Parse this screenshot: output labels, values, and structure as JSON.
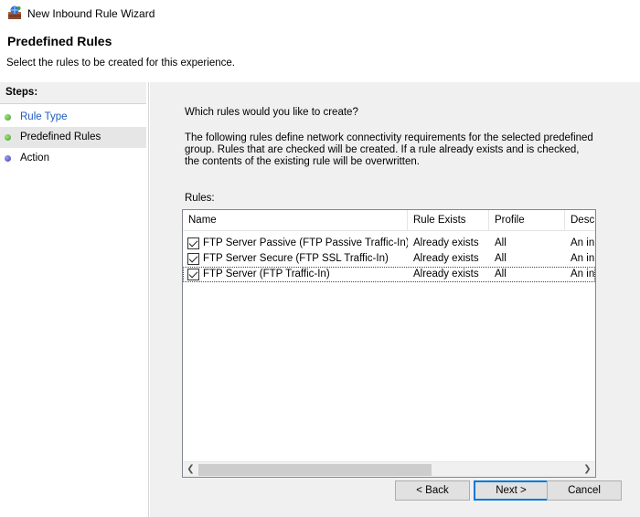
{
  "window": {
    "title": "New Inbound Rule Wizard",
    "icon": "firewall-wizard-icon"
  },
  "header": {
    "title": "Predefined Rules",
    "subtitle": "Select the rules to be created for this experience."
  },
  "steps": {
    "label": "Steps:",
    "items": [
      {
        "label": "Rule Type",
        "state": "done",
        "color": "#3f9c2c"
      },
      {
        "label": "Predefined Rules",
        "state": "current",
        "color": "#3f9c2c"
      },
      {
        "label": "Action",
        "state": "pending",
        "color": "#3e3fb0"
      }
    ]
  },
  "main": {
    "question": "Which rules would you like to create?",
    "description": "The following rules define network connectivity requirements for the selected predefined group. Rules that are checked will be created. If a rule already exists and is checked, the contents of the existing rule will be overwritten.",
    "rules_label": "Rules:",
    "columns": [
      "Name",
      "Rule Exists",
      "Profile",
      "Desc"
    ],
    "rows": [
      {
        "checked": true,
        "name": "FTP Server Passive (FTP Passive Traffic-In)",
        "exists": "Already exists",
        "profile": "All",
        "desc": "An in"
      },
      {
        "checked": true,
        "name": "FTP Server Secure (FTP SSL Traffic-In)",
        "exists": "Already exists",
        "profile": "All",
        "desc": "An in"
      },
      {
        "checked": true,
        "name": "FTP Server (FTP Traffic-In)",
        "exists": "Already exists",
        "profile": "All",
        "desc": "An in"
      }
    ]
  },
  "buttons": {
    "back": "< Back",
    "next": "Next >",
    "cancel": "Cancel"
  },
  "colors": {
    "step_link": "#1f5bbf",
    "default_button_border": "#0078d7"
  }
}
